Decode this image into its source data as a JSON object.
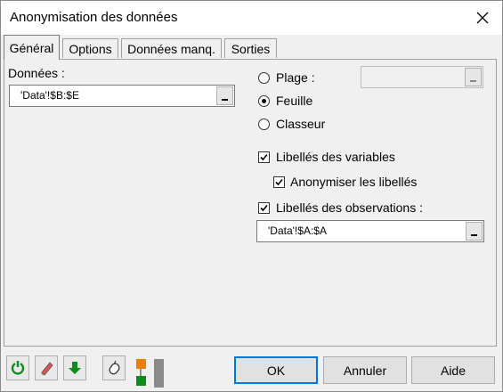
{
  "window": {
    "title": "Anonymisation des données"
  },
  "tabs": [
    {
      "label": "Général",
      "active": true
    },
    {
      "label": "Options"
    },
    {
      "label": "Données manq."
    },
    {
      "label": "Sorties"
    }
  ],
  "general": {
    "data_label": "Données :",
    "data_value": "'Data'!$B:$E",
    "range_value": "",
    "radios": [
      {
        "label": "Plage :",
        "checked": false
      },
      {
        "label": "Feuille",
        "checked": true
      },
      {
        "label": "Classeur",
        "checked": false
      }
    ],
    "checkboxes": {
      "var_labels": {
        "label": "Libellés des variables",
        "checked": true
      },
      "anon_labels": {
        "label": "Anonymiser les libellés",
        "checked": true
      },
      "obs_labels": {
        "label": "Libellés des observations :",
        "checked": true
      }
    },
    "obs_value": "'Data'!$A:$A"
  },
  "buttons": {
    "ok": "OK",
    "cancel": "Annuler",
    "help": "Aide"
  },
  "icons": [
    "reset-icon",
    "eraser-icon",
    "down-arrow-icon",
    "mouse-icon",
    "layout-toggle-icon"
  ],
  "colors": {
    "accent": "#0078d7",
    "green": "#0f8c1e",
    "orange": "#f07d00"
  }
}
